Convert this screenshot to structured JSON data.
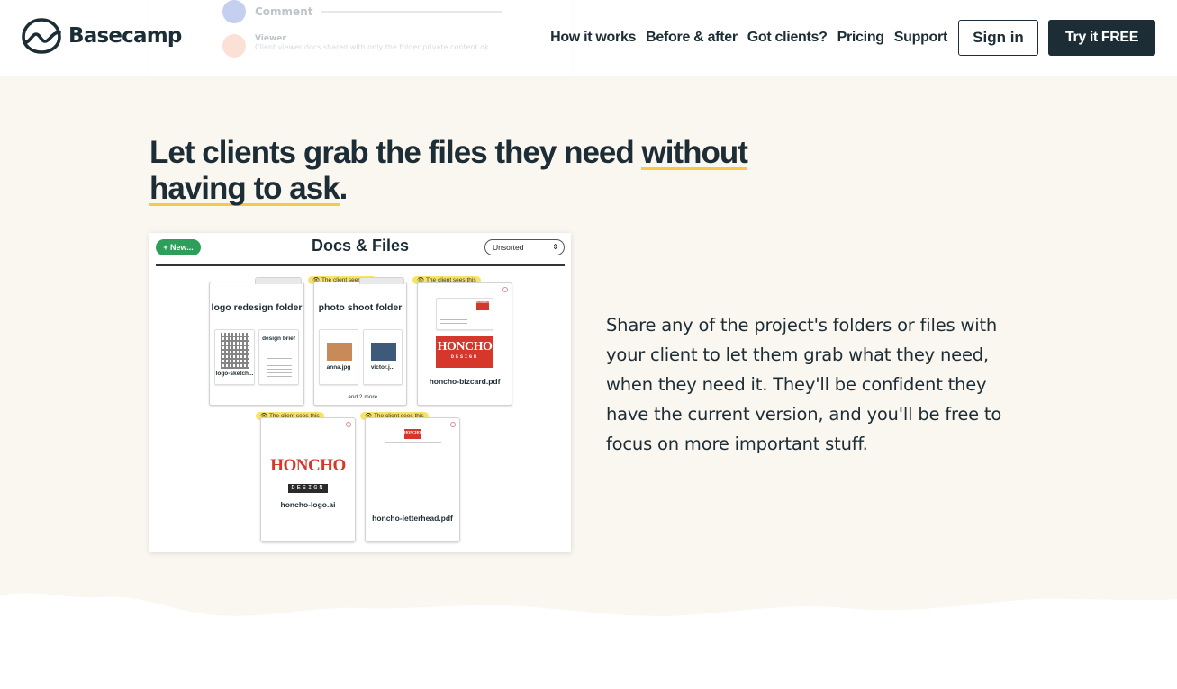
{
  "header": {
    "logo_text": "Basecamp",
    "nav": [
      "How it works",
      "Before & after",
      "Got clients?",
      "Pricing",
      "Support"
    ],
    "sign_in": "Sign in",
    "try_free": "Try it FREE"
  },
  "faded_card": {
    "comment_label": "Comment",
    "viewer_label": "Viewer",
    "viewer_note": "Client viewer docs shared with only the folder private content ok"
  },
  "section": {
    "headline_part1": "Let clients grab the files they need ",
    "headline_emph1": "without",
    "headline_emph2": "having to ask",
    "headline_end": ".",
    "description": "Share any of the project's folders or files with your client to let them grab what they need, when they need it. They'll be confident they have the current version, and you'll be free to focus on more important stuff."
  },
  "docs_screenshot": {
    "new_button": "+ New...",
    "title": "Docs & Files",
    "sort_label": "Unsorted",
    "sort_arrows": "⇕",
    "client_badge": "👁 The client sees this",
    "folder1_title": "logo redesign folder",
    "folder1_file1": "logo-sketch...",
    "folder1_file2": "design brief",
    "folder2_title": "photo shoot folder",
    "folder2_file1": "anna.jpg",
    "folder2_file2": "victor.j...",
    "folder2_more": "...and 2 more",
    "file3": "honcho-bizcard.pdf",
    "file4": "honcho-logo.ai",
    "file5": "honcho-letterhead.pdf",
    "brand_top": "HONCHO",
    "brand_bottom": "DESIGN"
  },
  "colors": {
    "ink": "#1d2d35",
    "cream": "#faf6f0",
    "highlight": "#f7c948",
    "new_green": "#2e9e5b",
    "honcho_red": "#d6372b"
  }
}
